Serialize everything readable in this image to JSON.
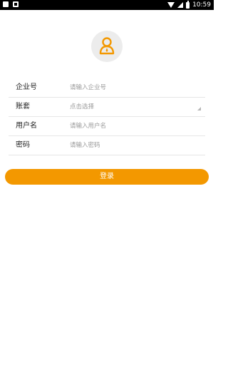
{
  "status_bar": {
    "time": "10:59",
    "icons": [
      "square-icon",
      "download-icon",
      "wifi-icon",
      "signal-icon",
      "battery-icon"
    ]
  },
  "avatar": {
    "icon": "user-avatar-icon",
    "icon_color": "#f39800",
    "background": "#ececec"
  },
  "form": {
    "company": {
      "label": "企业号",
      "placeholder": "请输入企业号"
    },
    "account_set": {
      "label": "账套",
      "placeholder": "点击选择"
    },
    "username": {
      "label": "用户名",
      "placeholder": "请输入用户名"
    },
    "password": {
      "label": "密码",
      "placeholder": "请输入密码"
    }
  },
  "login_button": {
    "label": "登录",
    "color": "#f39800"
  }
}
